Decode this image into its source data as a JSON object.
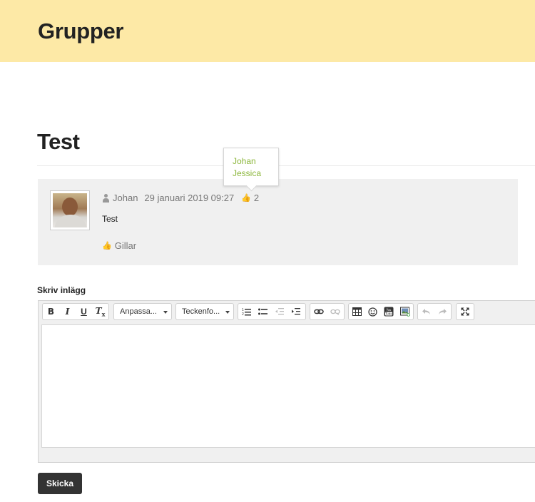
{
  "header": {
    "title": "Grupper",
    "background": "#fde9a6"
  },
  "page": {
    "title": "Test"
  },
  "post": {
    "author": "Johan",
    "date": "29 januari 2019 09:27",
    "like_count": "2",
    "text": "Test",
    "like_label": "Gillar",
    "avatar_icon": "user-photo"
  },
  "likes_tooltip": {
    "names": [
      "Johan",
      "Jessica"
    ],
    "color": "#8bb63a"
  },
  "form": {
    "label": "Skriv inlägg",
    "submit_label": "Skicka"
  },
  "toolbar": {
    "bold_label": "B",
    "italic_label": "I",
    "underline_label": "U",
    "clear_format_label": "Tx",
    "styles_combo": "Anpassa...",
    "font_combo": "Teckenfo..."
  }
}
